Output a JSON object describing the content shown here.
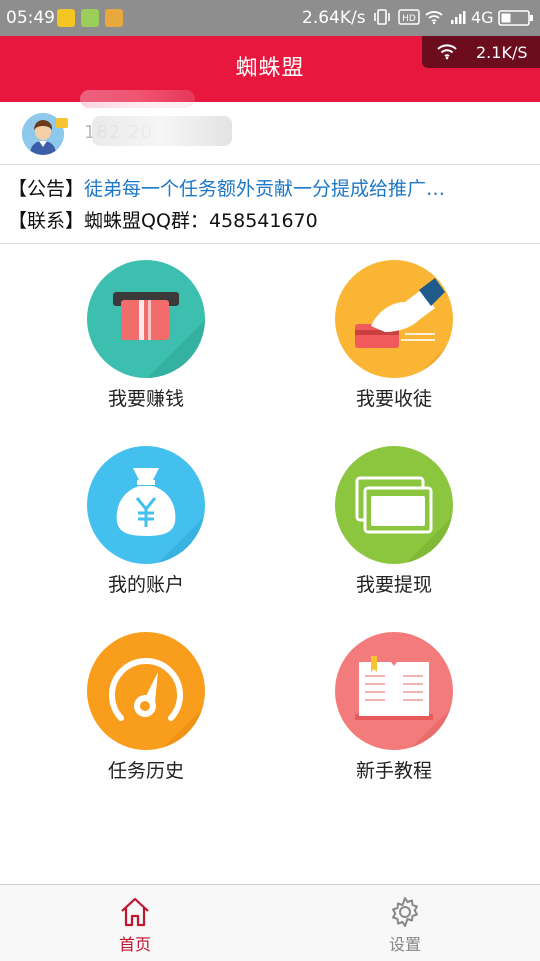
{
  "status_bar": {
    "time": "05:49",
    "net_speed": "2.64K/s",
    "hd_label": "HD",
    "network_type": "4G",
    "icons": [
      "notification-star-icon",
      "notification-app-icon",
      "notification-wallet-icon",
      "vibrate-icon",
      "hd-icon",
      "wifi-icon",
      "signal-icon",
      "battery-icon"
    ]
  },
  "header": {
    "title": "蜘蛛盟",
    "net_badge_rate": "2.1K/S",
    "color": "#e8173e"
  },
  "user": {
    "masked_id": "182",
    "masked_id_rest": "20"
  },
  "notice": {
    "announcement_tag": "【公告】",
    "announcement_text": "徒弟每一个任务额外贡献一分提成给推广…",
    "contact_tag": "【联系】",
    "contact_text": "蜘蛛盟QQ群：",
    "contact_number": "458541670"
  },
  "menu": [
    {
      "label": "我要赚钱",
      "icon": "atm-card-icon",
      "color": "#3cbfae"
    },
    {
      "label": "我要收徒",
      "icon": "hand-card-icon",
      "color": "#fbb534"
    },
    {
      "label": "我的账户",
      "icon": "money-bag-icon",
      "color": "#43c0ee"
    },
    {
      "label": "我要提现",
      "icon": "cards-icon",
      "color": "#8cc63f"
    },
    {
      "label": "任务历史",
      "icon": "speedometer-icon",
      "color": "#f99d1c"
    },
    {
      "label": "新手教程",
      "icon": "book-icon",
      "color": "#f47b7b"
    }
  ],
  "tabs": [
    {
      "label": "首页",
      "icon": "home-icon",
      "active": true
    },
    {
      "label": "设置",
      "icon": "gear-icon",
      "active": false
    }
  ],
  "colors": {
    "active_tab": "#c0142f",
    "inactive_tab": "#888888",
    "notice_link": "#1e78c8"
  }
}
